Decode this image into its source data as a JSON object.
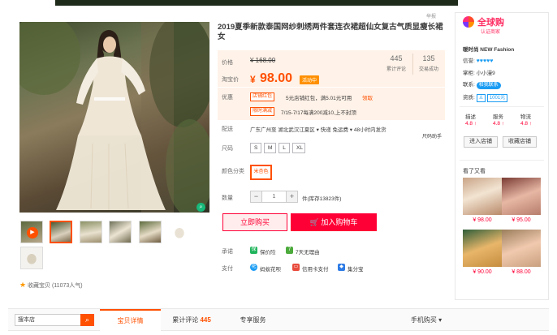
{
  "header": {
    "report_label": "举报"
  },
  "gallery": {
    "favorite_label": "收藏宝贝 (11073人气)",
    "zoom_icon": "magnifier-icon",
    "play_icon": "play-icon"
  },
  "product": {
    "title": "2019夏季新款泰国网纱刺绣两件套连衣裙超仙女复古气质显瘦长裙女",
    "price_label": "价格",
    "original_price": "¥ 168.00",
    "promo_label": "淘宝价",
    "current_symbol": "¥",
    "current_price": "98.00",
    "hot_badge": "活动中",
    "reviews_count": "445",
    "reviews_label": "累计评论",
    "sales_count": "135",
    "sales_label": "交易成功",
    "offers_label": "优惠",
    "tag_red_packet": "店铺红包",
    "red_packet_text": "5元店铺红包，满5.01元可用",
    "red_packet_link": "领取",
    "tag_discount": "限时满减",
    "discount_text": "7/15-7/17每满200减10,上不封顶",
    "shipping_label": "配送",
    "shipping_text": "广东广州至  湖北武汉江夏区 ▾   快递 免运费 ▾   48小时内发货",
    "shipping_note": "尺码助手",
    "size_label": "尺码",
    "sizes": [
      "S",
      "M",
      "L",
      "XL"
    ],
    "color_label": "颜色分类",
    "color_value": "米杏色",
    "qty_label": "数量",
    "qty_minus": "−",
    "qty_value": "1",
    "qty_plus": "+",
    "qty_stock": "件(库存13823件)",
    "buy_now": "立即购买",
    "add_cart": "加入购物车",
    "promise_label": "承诺",
    "promise_1": "保价险",
    "promise_2": "7天无理由",
    "pay_label": "支付",
    "pay_1": "蚂蚁花呗",
    "pay_2": "信用卡支付",
    "pay_3": "集分宝"
  },
  "shop": {
    "global_title": "全球购",
    "global_sub": "认证商家",
    "shop_name": "暖时尚 NEW Fashion",
    "credit_label": "信誉:",
    "credit_hearts": "♥♥♥♥♥",
    "seller_label": "掌柜:",
    "seller_name": "小小漫9",
    "contact_label": "联系:",
    "contact_badge": "和我联系",
    "qual_label": "资质:",
    "qual_value": "1001元",
    "score_labels": [
      "描述",
      "服务",
      "物流"
    ],
    "score_values": [
      "4.8 ↑",
      "4.8 ↑",
      "4.8 ↑"
    ],
    "enter_shop": "进入店铺",
    "follow_shop": "收藏店铺",
    "see_also": "看了又看",
    "rec_prices": [
      "¥ 98.00",
      "¥ 95.00",
      "¥ 90.00",
      "¥ 88.00"
    ]
  },
  "bottom": {
    "search_placeholder": "搜本店",
    "search_icon": "search-icon",
    "tabs": {
      "detail": "宝贝详情",
      "reviews": "累计评论",
      "reviews_count": "445",
      "service": "专享服务"
    },
    "mobile_buy": "手机购买 ▾"
  },
  "colors": {
    "accent": "#ff5000",
    "buy_red": "#ff0036",
    "price_bg": "#fff2e8",
    "global_pink": "#ff2e63",
    "link_blue": "#1a9cf3"
  }
}
